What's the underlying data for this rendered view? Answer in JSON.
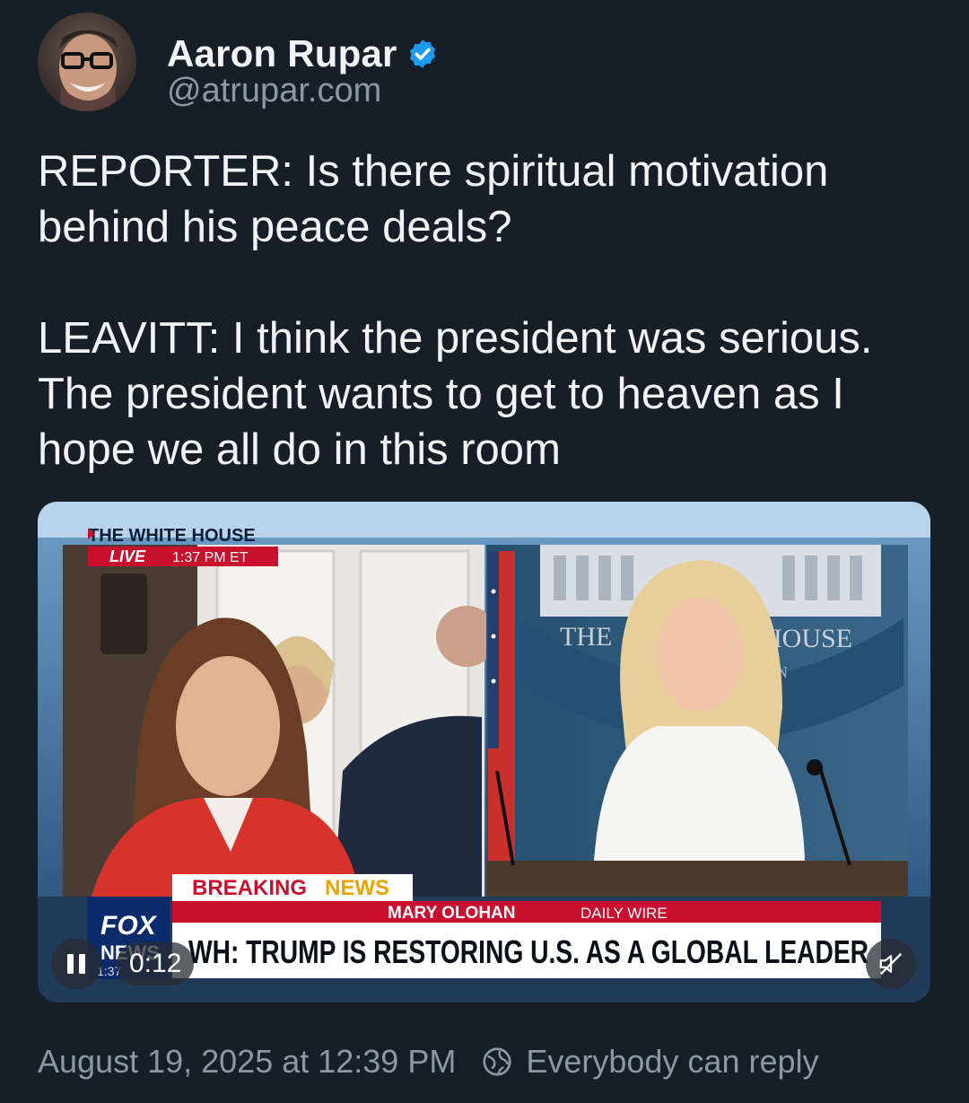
{
  "author": {
    "name": "Aaron Rupar",
    "handle": "@atrupar.com",
    "verified": true
  },
  "post": {
    "text": "REPORTER: Is there spiritual motivation behind his peace deals?\n\nLEAVITT: I think the president was serious. The president wants to get to heaven as I hope we all do in this room"
  },
  "video": {
    "overlay": {
      "location": "THE WHITE HOUSE",
      "live": "LIVE",
      "time": "1:37 PM ET",
      "banner_breaking": "BREAKING",
      "banner_news": "NEWS",
      "reporter_credit": "MARY OLOHAN",
      "outlet": "DAILY WIRE",
      "headline": "WH: TRUMP IS RESTORING U.S. AS A GLOBAL LEADER",
      "network_top": "FOX",
      "network_bottom": "NEWS",
      "network_clock": "1:37",
      "seal_left": "THE",
      "seal_right": "HOUSE",
      "seal_sub": "ON"
    },
    "elapsed": "0:12",
    "state": "playing",
    "muted": true
  },
  "footer": {
    "timestamp": "August 19, 2025 at 12:39 PM",
    "reply_setting": "Everybody can reply"
  },
  "colors": {
    "background": "#161e27",
    "verified": "#1d9bf0",
    "secondary_text": "#8b98a5",
    "breaking_red": "#c8102e"
  }
}
